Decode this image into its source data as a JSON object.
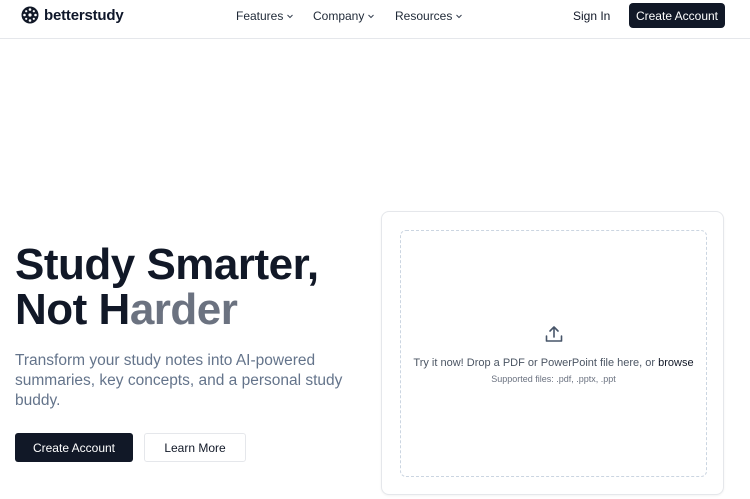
{
  "header": {
    "brand": "betterstudy",
    "nav": [
      {
        "label": "Features"
      },
      {
        "label": "Company"
      },
      {
        "label": "Resources"
      }
    ],
    "sign_in": "Sign In",
    "create_account": "Create Account"
  },
  "hero": {
    "title_line1": "Study Smarter,",
    "title_line2_part1": "Not H",
    "title_line2_part2": "arder",
    "subtitle": "Transform your study notes into AI-powered summaries, key concepts, and a personal study buddy.",
    "primary_button": "Create Account",
    "secondary_button": "Learn More"
  },
  "upload": {
    "prompt": "Try it now! Drop a PDF or PowerPoint file here, or ",
    "browse": "browse",
    "supported": "Supported files: .pdf, .pptx, .ppt"
  },
  "colors": {
    "primary": "#111827",
    "muted_text": "#64748b",
    "border": "#e5e7eb"
  }
}
